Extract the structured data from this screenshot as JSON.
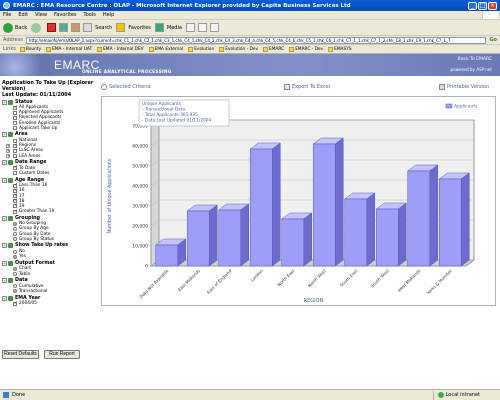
{
  "window": {
    "title": "EMARC : EMA Resource Centre : OLAP - Microsoft Internet Explorer provided by Capita Business Services Ltd"
  },
  "menu": {
    "items": [
      "File",
      "Edit",
      "View",
      "Favorites",
      "Tools",
      "Help"
    ]
  },
  "toolbar": {
    "back": "Back",
    "search": "Search",
    "favorites": "Favorites",
    "media": "Media"
  },
  "address": {
    "label": "Address",
    "url": "http://emainfo/ema/OLAP_2.aspx?current=chk_C1_1,chk_C2_1,chk_C3_1,chk_C4_1,chk_C4_2,chk_C4_3,chk_C4_4,chk_C4_5,chk_C4_6,chk_C5_1,chk_C6_1,chk_C7_1_1,chk_C7_1_2,chk_C8_1,chk_C9_1,chk_C7_1_7",
    "go": "Go"
  },
  "links": {
    "label": "Links",
    "items": [
      "Bounty",
      "EMA - Internal UAT",
      "EMA - Internal DEV",
      "EMA External",
      "Evolution",
      "Evolution - Dev",
      "EMARC",
      "EMARC - Dev",
      "EMASYS"
    ]
  },
  "banner": {
    "logo": "EMARC",
    "subtitle": "ONLINE ANALYTICAL PROCESSING",
    "back_link": "Back To EMARC",
    "powered": "powered by ASP.net"
  },
  "criteria": {
    "heading": "Application To Take Up (Explorer Version)",
    "last_update": "Last Update: 01/11/2004",
    "groups": [
      {
        "title": "Status",
        "type": "checkbox",
        "options": [
          {
            "label": "All Applicants",
            "checked": true
          },
          {
            "label": "Approved Applicants",
            "checked": false
          },
          {
            "label": "Rejected Applicants",
            "checked": false
          },
          {
            "label": "Enrolled Applicants",
            "checked": false
          },
          {
            "label": "Applicant Take Up",
            "checked": false
          }
        ]
      },
      {
        "title": "Area",
        "type": "checkbox",
        "options": [
          {
            "label": "National",
            "checked": false
          },
          {
            "label": "Regions",
            "checked": true
          },
          {
            "label": "LLSC Areas",
            "checked": false
          },
          {
            "label": "LEA Areas",
            "checked": false
          }
        ]
      },
      {
        "title": "Date Range",
        "type": "checkbox",
        "options": [
          {
            "label": "To Date",
            "checked": true
          },
          {
            "label": "Custom Dates",
            "checked": false
          }
        ]
      },
      {
        "title": "Age Range",
        "type": "checkbox",
        "options": [
          {
            "label": "Less Than 16",
            "checked": true
          },
          {
            "label": "16",
            "checked": true
          },
          {
            "label": "17",
            "checked": true
          },
          {
            "label": "18",
            "checked": true
          },
          {
            "label": "19",
            "checked": true
          },
          {
            "label": "Greater Than 19",
            "checked": true
          }
        ]
      },
      {
        "title": "Grouping",
        "type": "radio",
        "options": [
          {
            "label": "No Grouping",
            "checked": true
          },
          {
            "label": "Group By Age",
            "checked": false
          },
          {
            "label": "Group By Date",
            "checked": false
          },
          {
            "label": "Group By Status",
            "checked": false
          }
        ]
      },
      {
        "title": "Show Take Up rates",
        "type": "radio",
        "options": [
          {
            "label": "No",
            "checked": false
          },
          {
            "label": "Yes",
            "checked": true
          }
        ]
      },
      {
        "title": "Output Format",
        "type": "radio",
        "options": [
          {
            "label": "Chart",
            "checked": true
          },
          {
            "label": "Table",
            "checked": false
          }
        ]
      },
      {
        "title": "Data",
        "type": "radio",
        "options": [
          {
            "label": "Cumulative",
            "checked": false
          },
          {
            "label": "Transactional",
            "checked": true
          }
        ]
      },
      {
        "title": "EMA Year",
        "type": "checkbox",
        "options": [
          {
            "label": "2004/05",
            "checked": true
          }
        ]
      }
    ],
    "reset_label": "Reset Defaults",
    "run_label": "Run Report"
  },
  "actions": {
    "selected": "Selected Criteria",
    "export": "Export To Excel",
    "print": "Printable Version"
  },
  "chart_data": {
    "type": "bar",
    "notes": [
      "Unique Applicants",
      "- Transactional Data",
      "- Total Applicants 365,935",
      "- Data Last Updated 01/11/2004"
    ],
    "legend": "Applicants",
    "xlabel": "REGION",
    "ylabel": "Number of Unique Applications",
    "ylim": [
      0,
      70000
    ],
    "yticks": [
      "0",
      "10,000",
      "20,000",
      "30,000",
      "40,000",
      "50,000",
      "60,000",
      "70,000"
    ],
    "categories": [
      "Data Not Available",
      "East Midlands",
      "East of England",
      "London",
      "North East",
      "North West",
      "South East",
      "South West",
      "West Midlands",
      "Yorks & Humber"
    ],
    "values": [
      10500,
      27500,
      28000,
      58500,
      23500,
      61000,
      33500,
      28500,
      47500,
      43500
    ],
    "colors": {
      "bar": "#9d9dfa",
      "bar_top": "#c4c4ff",
      "bar_side": "#6b6bd0",
      "panel": "#f0f0f0",
      "wall": "#e8e8e8"
    }
  },
  "status": {
    "left": "Done",
    "zone": "Local intranet"
  }
}
